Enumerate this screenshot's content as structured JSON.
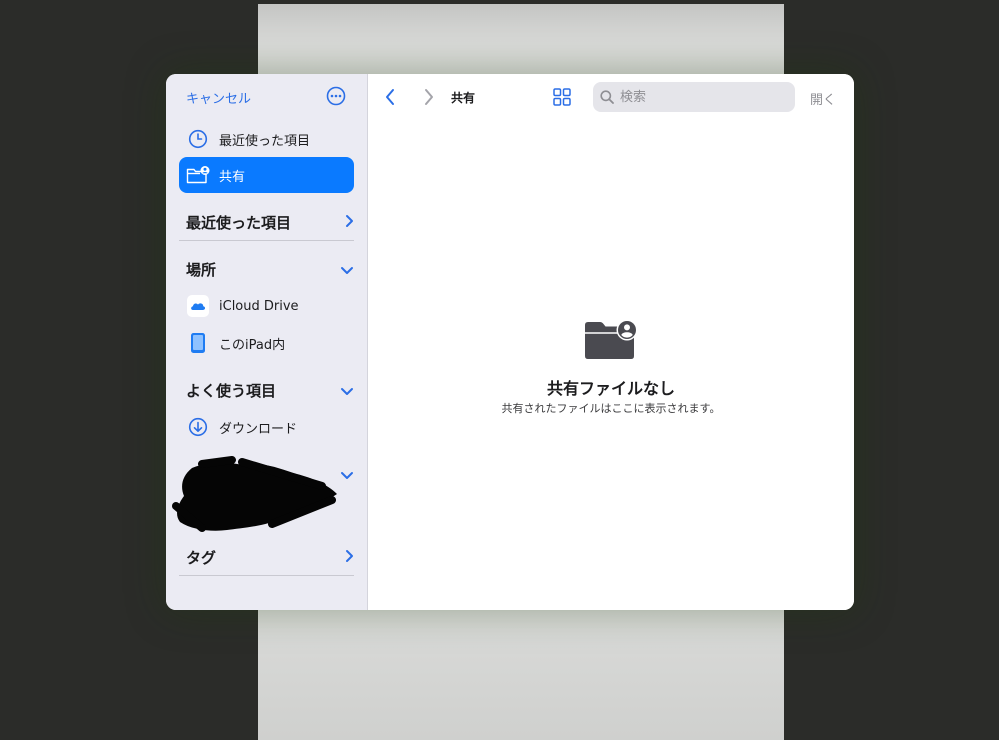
{
  "sidebar": {
    "cancel_label": "キャンセル",
    "items": [
      {
        "label": "最近使った項目",
        "icon": "clock-icon"
      },
      {
        "label": "共有",
        "icon": "shared-folder-icon",
        "selected": true
      }
    ],
    "sections": {
      "recents": {
        "title": "最近使った項目"
      },
      "locations": {
        "title": "場所",
        "items": [
          {
            "label": "iCloud Drive",
            "icon": "icloud-icon"
          },
          {
            "label": "このiPad内",
            "icon": "ipad-icon"
          }
        ]
      },
      "favorites": {
        "title": "よく使う項目",
        "items": [
          {
            "label": "ダウンロード",
            "icon": "download-icon"
          }
        ]
      },
      "tags": {
        "title": "タグ"
      }
    }
  },
  "toolbar": {
    "current_folder": "共有",
    "search_placeholder": "検索",
    "open_label": "開く"
  },
  "empty_state": {
    "title": "共有ファイルなし",
    "subtitle": "共有されたファイルはここに表示されます。"
  },
  "colors": {
    "accent": "#0a7aff",
    "sidebar_bg": "#ebebf3",
    "backdrop": "#2b2c29"
  }
}
